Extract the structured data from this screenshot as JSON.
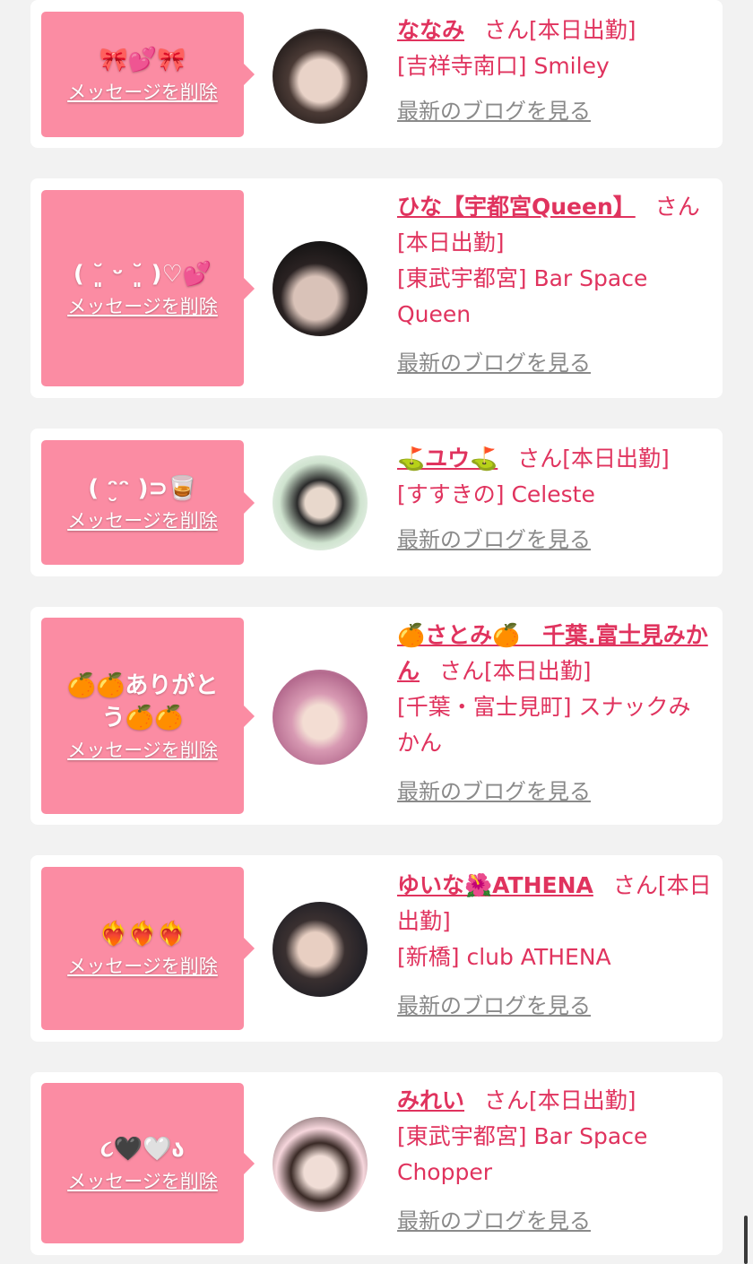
{
  "delete_label": "メッセージを削除",
  "san_suffix": "さん",
  "blog_label": "最新のブログを見る",
  "colors": {
    "bubble": "#fb8ca3",
    "name": "#e0335e",
    "blog_link": "#8a8a8a",
    "background": "#f2f2f2"
  },
  "cards": [
    {
      "message": "🎀💕🎀",
      "name": "ななみ",
      "status": "[本日出勤]",
      "shop": "[吉祥寺南口] Smiley"
    },
    {
      "message": "( ˘͈ ᵕ ˘͈ )♡💕",
      "name": "ひな【宇都宮Queen】",
      "status": "[本日出勤]",
      "shop": "[東武宇都宮] Bar Space Queen"
    },
    {
      "message": "( ᵔ̮ᵔ )⊃🥃",
      "name": "⛳ユウ⛳",
      "status": "[本日出勤]",
      "shop": "[すすきの] Celeste"
    },
    {
      "message": "🍊🍊ありがとう🍊🍊",
      "name": "🍊さとみ🍊　千葉.富士見みかん",
      "status": "[本日出勤]",
      "shop": "[千葉・富士見町] スナックみかん"
    },
    {
      "message": "❤️‍🔥❤️‍🔥❤️‍🔥",
      "name": "ゆいな🌺ATHENA",
      "status": "[本日出勤]",
      "shop": "[新橋] club ATHENA"
    },
    {
      "message": "૮🖤🤍ა",
      "name": "みれい",
      "status": "[本日出勤]",
      "shop": "[東武宇都宮] Bar Space Chopper"
    }
  ]
}
